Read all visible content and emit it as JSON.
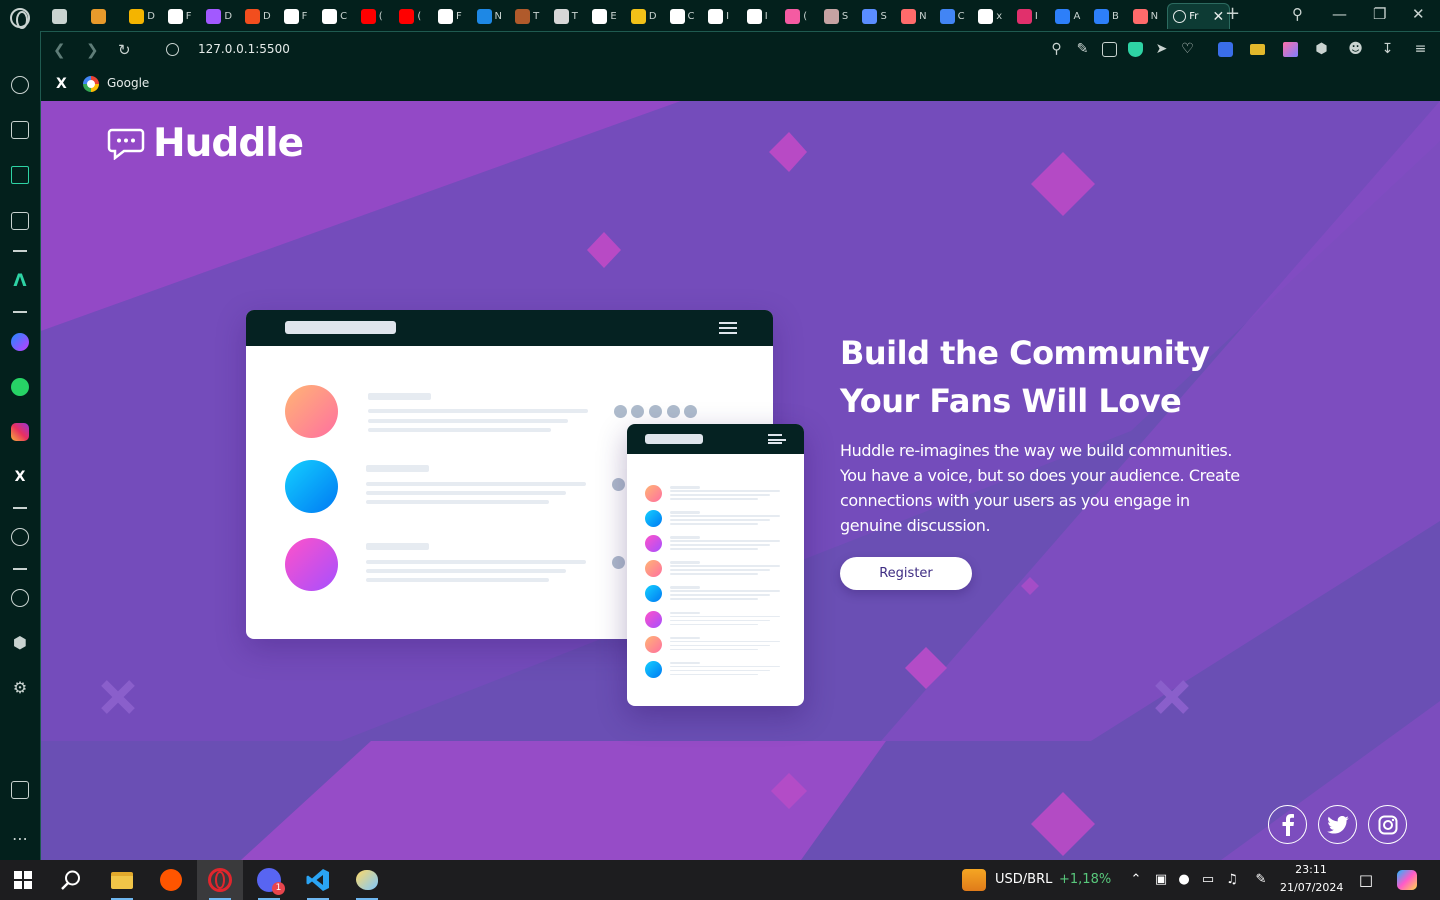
{
  "browser": {
    "tabs": [
      {
        "label": "",
        "icon": "controller-icon",
        "color": "#c9d3d0"
      },
      {
        "label": "",
        "icon": "lion-icon",
        "color": "#e89a2b"
      },
      {
        "label": "D",
        "icon": "drive-icon",
        "color": "#f4b400"
      },
      {
        "label": "F",
        "icon": "file-icon",
        "color": "#ffffff"
      },
      {
        "label": "D",
        "icon": "figma-icon",
        "color": "#a259ff"
      },
      {
        "label": "D",
        "icon": "figma-icon",
        "color": "#f24e1e"
      },
      {
        "label": "F",
        "icon": "github-icon",
        "color": "#ffffff"
      },
      {
        "label": "C",
        "icon": "notion-icon",
        "color": "#ffffff"
      },
      {
        "label": "(",
        "icon": "youtube-icon",
        "color": "#ff0000"
      },
      {
        "label": "(",
        "icon": "youtube-icon",
        "color": "#ff0000"
      },
      {
        "label": "F",
        "icon": "file-icon",
        "color": "#ffffff"
      },
      {
        "label": "N",
        "icon": "d-icon",
        "color": "#1e88e5"
      },
      {
        "label": "T",
        "icon": "moth-icon",
        "color": "#b05a2b"
      },
      {
        "label": "T",
        "icon": "openai-icon",
        "color": "#d7d7d7"
      },
      {
        "label": "E",
        "icon": "e-icon",
        "color": "#ffffff"
      },
      {
        "label": "D",
        "icon": "chart-icon",
        "color": "#f2c118"
      },
      {
        "label": "C",
        "icon": "cursor-icon",
        "color": "#ffffff"
      },
      {
        "label": "I",
        "icon": "tsuki-icon",
        "color": "#ffffff"
      },
      {
        "label": "I",
        "icon": "tsuki-icon",
        "color": "#ffffff"
      },
      {
        "label": "(",
        "icon": "pink-circle-icon",
        "color": "#f45ba2"
      },
      {
        "label": "S",
        "icon": "photo-icon",
        "color": "#c6a3a3"
      },
      {
        "label": "S",
        "icon": "hs-icon",
        "color": "#5a8dff"
      },
      {
        "label": "N",
        "icon": "cake-icon",
        "color": "#ff6b6b"
      },
      {
        "label": "C",
        "icon": "translate-icon",
        "color": "#4285f4"
      },
      {
        "label": "x",
        "icon": "x-icon",
        "color": "#ffffff"
      },
      {
        "label": "I",
        "icon": "instagram-icon",
        "color": "#e1306c"
      },
      {
        "label": "A",
        "icon": "a-icon",
        "color": "#2d7ff9"
      },
      {
        "label": "B",
        "icon": "b-icon",
        "color": "#2d7ff9"
      },
      {
        "label": "N",
        "icon": "cake-icon",
        "color": "#ff6b6b"
      }
    ],
    "active_tab": {
      "label": "Fr",
      "icon": "globe-icon"
    },
    "address": "127.0.0.1:5500",
    "bookmarks": [
      {
        "label": "",
        "icon": "x-icon"
      },
      {
        "label": "Google",
        "icon": "google-icon"
      }
    ]
  },
  "page": {
    "brand": "Huddle",
    "hero_title_line1": "Build the Community",
    "hero_title_line2": "Your Fans Will Love",
    "hero_text": "Huddle re-imagines the way we build communities. You have a voice, but so does your audience. Create connections with your users as you engage in genuine discussion.",
    "cta_label": "Register",
    "social": [
      "facebook-icon",
      "twitter-icon",
      "instagram-icon"
    ],
    "colors": {
      "background": "#6a4fb4",
      "accent": "#a348c9",
      "cta_text": "#3f2d83"
    }
  },
  "taskbar": {
    "ticker": "USD/BRL",
    "ticker_change": "+1,18%",
    "time": "23:11",
    "date": "21/07/2024",
    "apps": [
      "start-icon",
      "search-icon",
      "file-explorer-icon",
      "soundcloud-icon",
      "opera-gx-icon",
      "discord-icon",
      "vscode-icon",
      "paint-icon"
    ],
    "discord_badge": "1"
  }
}
